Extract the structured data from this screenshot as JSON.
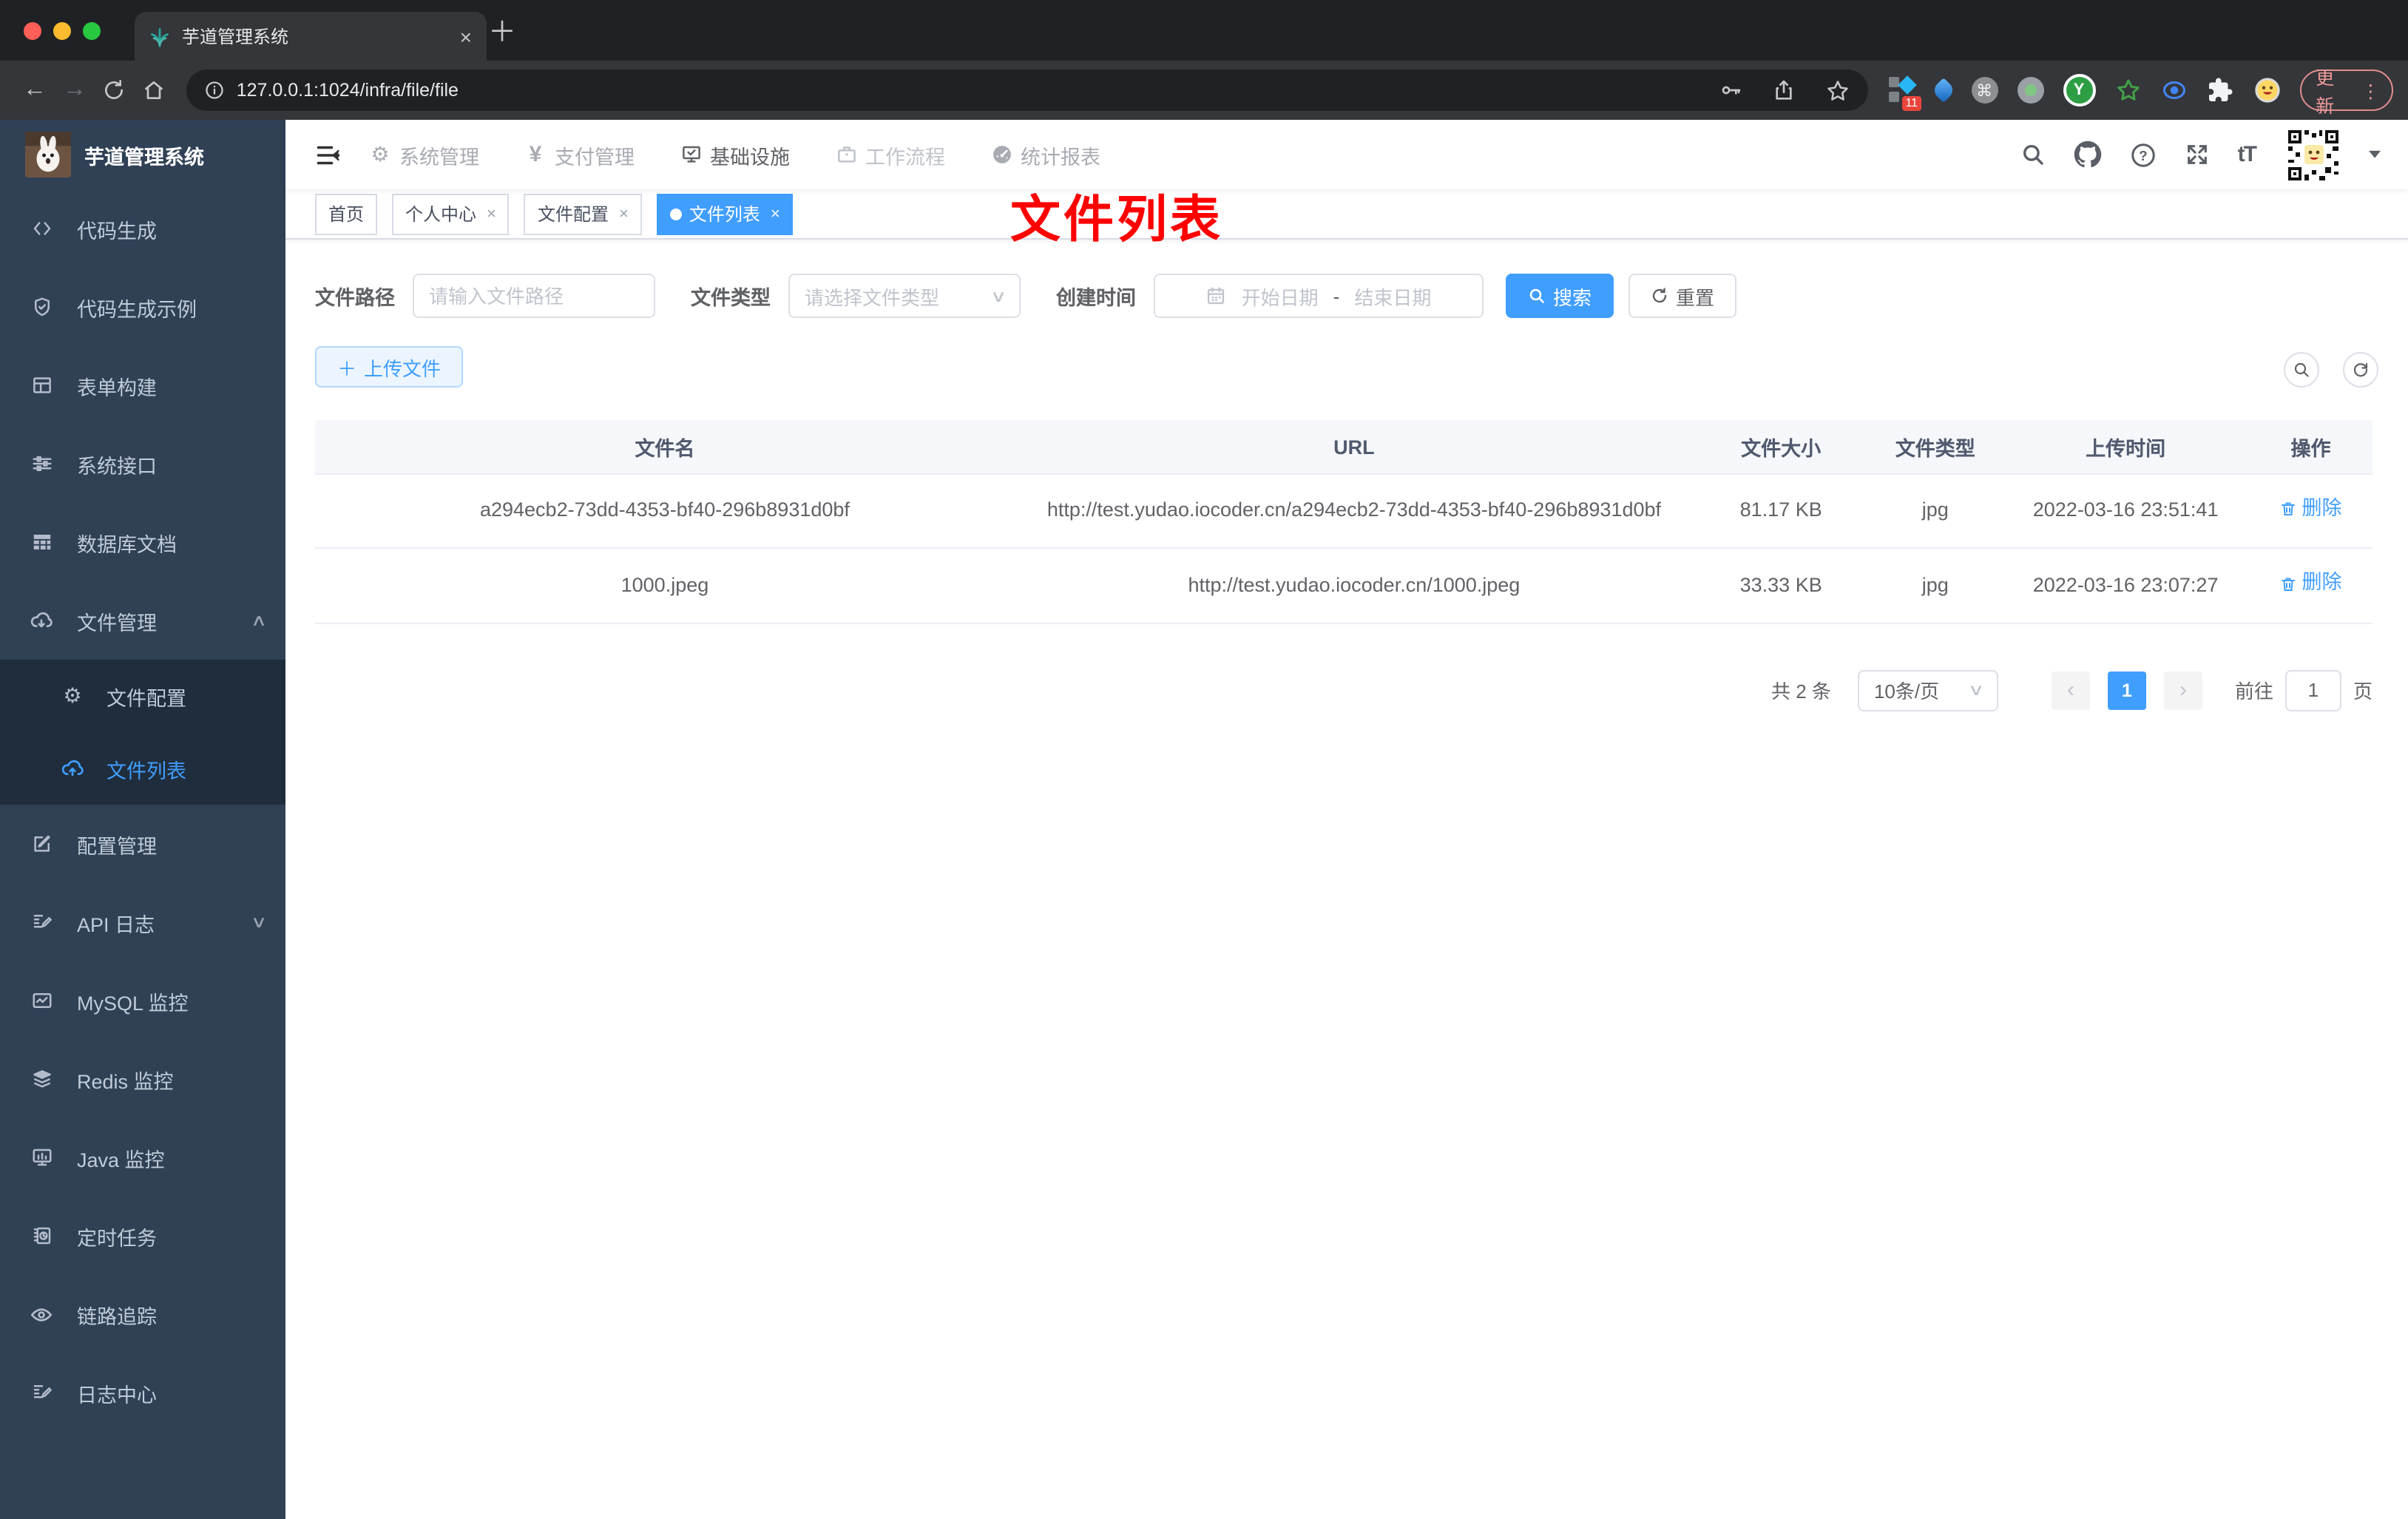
{
  "browser": {
    "tab_title": "芋道管理系统",
    "url": "127.0.0.1:1024/infra/file/file",
    "update_label": "更新",
    "ext_badge_count": "11"
  },
  "sidebar": {
    "title": "芋道管理系统",
    "menu": [
      {
        "label": "代码生成"
      },
      {
        "label": "代码生成示例"
      },
      {
        "label": "表单构建"
      },
      {
        "label": "系统接口"
      },
      {
        "label": "数据库文档"
      },
      {
        "label": "文件管理"
      },
      {
        "label": "文件配置"
      },
      {
        "label": "文件列表"
      },
      {
        "label": "配置管理"
      },
      {
        "label": "API 日志"
      },
      {
        "label": "MySQL 监控"
      },
      {
        "label": "Redis 监控"
      },
      {
        "label": "Java 监控"
      },
      {
        "label": "定时任务"
      },
      {
        "label": "链路追踪"
      },
      {
        "label": "日志中心"
      }
    ]
  },
  "topnav": {
    "items": [
      {
        "label": "系统管理"
      },
      {
        "label": "支付管理"
      },
      {
        "label": "基础设施"
      },
      {
        "label": "工作流程"
      },
      {
        "label": "统计报表"
      }
    ]
  },
  "tags": {
    "items": [
      {
        "label": "首页"
      },
      {
        "label": "个人中心"
      },
      {
        "label": "文件配置"
      },
      {
        "label": "文件列表"
      }
    ]
  },
  "annotation": {
    "text": "文件列表",
    "color": "#ff0000"
  },
  "filter": {
    "path_label": "文件路径",
    "path_placeholder": "请输入文件路径",
    "type_label": "文件类型",
    "type_placeholder": "请选择文件类型",
    "time_label": "创建时间",
    "start_placeholder": "开始日期",
    "separator": "-",
    "end_placeholder": "结束日期",
    "search_label": "搜索",
    "reset_label": "重置"
  },
  "toolbar": {
    "upload_label": "上传文件"
  },
  "table": {
    "headers": [
      "文件名",
      "URL",
      "文件大小",
      "文件类型",
      "上传时间",
      "操作"
    ],
    "rows": [
      {
        "name": "a294ecb2-73dd-4353-bf40-296b8931d0bf",
        "url": "http://test.yudao.iocoder.cn/a294ecb2-73dd-4353-bf40-296b8931d0bf",
        "size": "81.17 KB",
        "type": "jpg",
        "time": "2022-03-16 23:51:41",
        "action": "删除"
      },
      {
        "name": "1000.jpeg",
        "url": "http://test.yudao.iocoder.cn/1000.jpeg",
        "size": "33.33 KB",
        "type": "jpg",
        "time": "2022-03-16 23:07:27",
        "action": "删除"
      }
    ]
  },
  "pagination": {
    "total": "共 2 条",
    "page_size": "10条/页",
    "current_page": "1",
    "goto_label": "前往",
    "goto_value": "1",
    "page_label": "页"
  },
  "colors": {
    "accent": "#409eff",
    "sidebar_bg": "#304156",
    "submenu_bg": "#1f2d3d",
    "annotation_red": "#ff0000"
  },
  "icons": {
    "yen": "¥",
    "plus": "＋",
    "close": "×",
    "chevron_up": "∧",
    "chevron_down": "∨",
    "dots": "⋮",
    "prev": "‹",
    "next": "›",
    "gear": "⚙",
    "question": "?",
    "font_size": "tT",
    "back": "←",
    "forward": "→",
    "cmd": "⌘",
    "y_letter": "Y",
    "dash": "-",
    "caret_down": "▾"
  }
}
